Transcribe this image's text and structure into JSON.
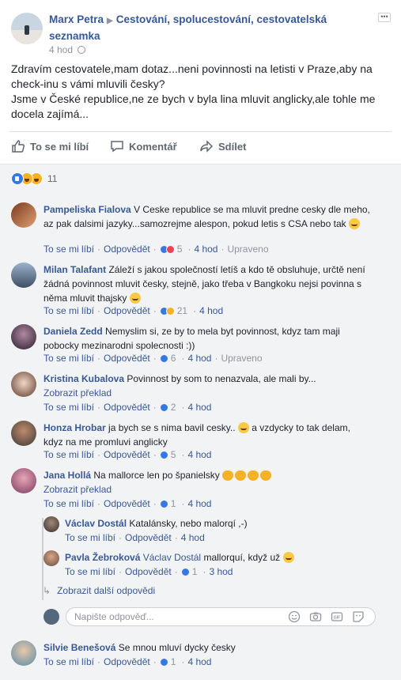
{
  "post": {
    "author": "Marx Petra",
    "group": "Cestování, spolucestování, cestovatelská seznamka",
    "time": "4 hod",
    "text": "Zdravím cestovatele,mam dotaz...neni povinnosti na letisti v Praze,aby na check-inu s vámi mluvili česky?\nJsme v České republice,ne ze bych v byla lina mluvit anglicky,ale tohle me docela zajímá...",
    "actions": {
      "like": "To se mi líbí",
      "comment": "Komentář",
      "share": "Sdílet"
    },
    "reactions_count": "11"
  },
  "labels": {
    "like": "To se mi líbí",
    "reply": "Odpovědět",
    "translate": "Zobrazit překlad",
    "edited": "Upraveno"
  },
  "comments": [
    {
      "author": "Pampeliska Fialova",
      "text": "V Ceske republice se ma mluvit predne cesky dle meho, az pak dalsimi jazyky...samozrejme alespon, pokud letis s CSA nebo tak",
      "reactions": "5",
      "time": "4 hod"
    },
    {
      "author": "Milan Talafant",
      "text": "Záleží s jakou společností letíš a kdo tě obsluhuje, určtě není žádná povinnost mluvit česky, stejně, jako třeba v Bangkoku nejsi povinna s něma mluvit thajsky",
      "reactions": "21",
      "time": "4 hod"
    },
    {
      "author": "Daniela Zedd",
      "text": "Nemyslim si, ze by to mela byt povinnost, kdyz tam maji pobocky mezinarodni spolecnosti :))",
      "reactions": "6",
      "time": "4 hod"
    },
    {
      "author": "Kristina Kubalova",
      "text": "Povinnost by som to nenazvala, ale mali by...",
      "reactions": "2",
      "time": "4 hod"
    },
    {
      "author": "Honza Hrobar",
      "text": "ja bych se s nima bavil cesky..",
      "text2": "a vzdycky to tak delam, kdyz na me promluvi anglicky",
      "reactions": "5",
      "time": "4 hod"
    },
    {
      "author": "Jana Hollá",
      "text": "Na mallorce len po španielsky",
      "reactions": "1",
      "time": "4 hod"
    }
  ],
  "replies": [
    {
      "author": "Václav Dostál",
      "text": "Katalánsky, nebo malorqí ,-)",
      "time": "4 hod"
    },
    {
      "author": "Pavla Žebroková",
      "tag": "Václav Dostál",
      "text": "mallorquí, když už",
      "reactions": "1",
      "time": "3 hod"
    }
  ],
  "more_replies": "Zobrazit další odpovědi",
  "reply_input": {
    "placeholder": "Napište odpověď..."
  },
  "last_comment": {
    "author": "Silvie Benešová",
    "text": "Se mnou mluví dycky česky",
    "reactions": "1",
    "time": "4 hod"
  },
  "colors": {
    "link": "#385898",
    "meta": "#90949c",
    "like": "#3578e5",
    "love": "#f33e58",
    "emoji": "#f7b125"
  }
}
